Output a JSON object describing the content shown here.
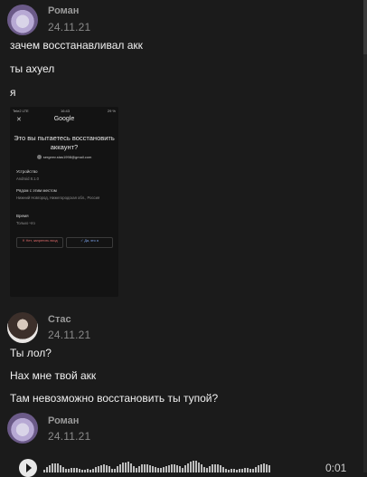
{
  "messages": [
    {
      "author": "Роман",
      "date": "24.11.21",
      "lines": [
        "зачем восстанавливал акк",
        "ты ахуел",
        "я"
      ]
    },
    {
      "author": "Стас",
      "date": "24.11.21",
      "lines": [
        "Ты лол?",
        "Нах мне твой акк",
        "Там невозможно восстановить ты тупой?"
      ]
    },
    {
      "author": "Роман",
      "date": "24.11.21",
      "audio": {
        "duration": "0:01"
      }
    }
  ],
  "screenshot": {
    "status_left": "Tele2 LTE",
    "status_time": "16:43",
    "status_right": "29 %",
    "brand": "Google",
    "close": "✕",
    "question": "Это вы пытаетесь восстановить аккаунт?",
    "email": "sergeev.stas1998@gmail.com",
    "device_label": "Устройство",
    "device_value": "Android 8.1.0",
    "location_label": "Рядом с этим местом",
    "location_value": "Нижний Новгород, Нижегородская обл., Россия",
    "time_label": "Время",
    "time_value": "Только что",
    "no_button": "✕  Нет, запретить вход",
    "yes_button": "✓  Да, это я"
  },
  "icons": {
    "play": "play-icon"
  }
}
